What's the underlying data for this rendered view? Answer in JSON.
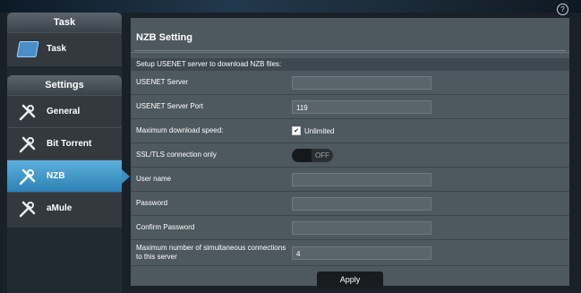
{
  "help_icon": "?",
  "sidebar": {
    "task_group": {
      "title": "Task",
      "items": [
        {
          "label": "Task",
          "icon": "task-icon"
        }
      ]
    },
    "settings_group": {
      "title": "Settings",
      "items": [
        {
          "label": "General",
          "icon": "wrench-screwdriver-icon"
        },
        {
          "label": "Bit Torrent",
          "icon": "wrench-screwdriver-icon"
        },
        {
          "label": "NZB",
          "icon": "wrench-screwdriver-icon",
          "active": true
        },
        {
          "label": "aMule",
          "icon": "wrench-screwdriver-icon"
        }
      ]
    }
  },
  "panel": {
    "title": "NZB Setting",
    "description": "Setup USENET server to download NZB files:",
    "fields": {
      "usenet_server": {
        "label": "USENET Server",
        "value": ""
      },
      "usenet_port": {
        "label": "USENET Server Port",
        "value": "119"
      },
      "max_speed": {
        "label": "Maximum download speed:",
        "checkbox_label": "Unlimited",
        "checked": true
      },
      "ssl": {
        "label": "SSL/TLS connection only",
        "toggle_text": "OFF"
      },
      "username": {
        "label": "User name",
        "value": ""
      },
      "password": {
        "label": "Password",
        "value": ""
      },
      "confirm_password": {
        "label": "Confirm Password",
        "value": ""
      },
      "max_connections": {
        "label": "Maximum number of simultaneous connections to this server",
        "value": "4"
      }
    },
    "apply_label": "Apply"
  }
}
